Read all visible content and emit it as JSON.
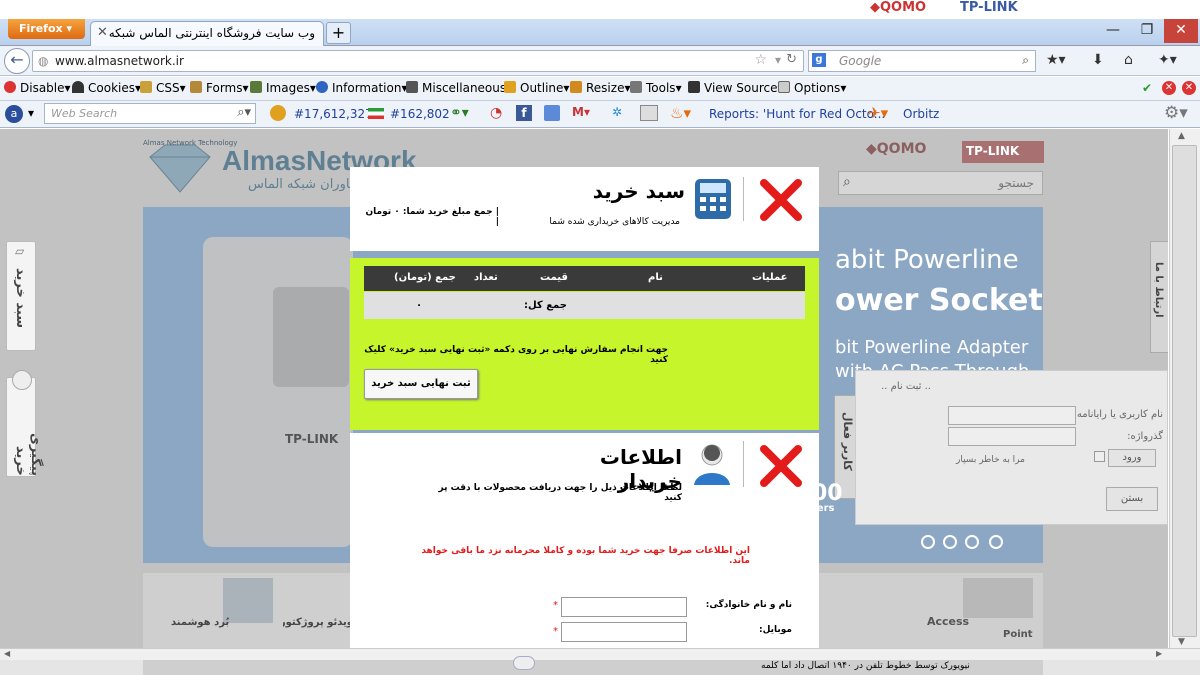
{
  "browser": {
    "app_menu": "Firefox",
    "tab_title": "وب سایت فروشگاه اینترنتی الماس شبکه",
    "new_tab": "+",
    "url": "www.almasnetwork.ir",
    "search_placeholder": "Google",
    "window_buttons": [
      "—",
      "❐",
      "✕"
    ]
  },
  "dev_toolbar": {
    "items": [
      "Disable",
      "Cookies",
      "CSS",
      "Forms",
      "Images",
      "Information",
      "Miscellaneous",
      "Outline",
      "Resize",
      "Tools",
      "View Source",
      "Options"
    ]
  },
  "third_toolbar": {
    "web_search_placeholder": "Web Search",
    "alexa_rank": "#17,612,327",
    "country_rank": "#162,802",
    "news": "Reports: 'Hunt for Red Octo...",
    "orbitz": "Orbitz"
  },
  "site": {
    "logo_name": "AlmasNetwork",
    "logo_sub": "فناوران شبکه الماس",
    "logo_tagline": "Almas Network Technology",
    "search_placeholder": "جستجو",
    "banner_line1": "abit Powerline",
    "banner_line2": "ower Socket",
    "banner_line3": "bit Powerline Adapter",
    "banner_line4": "with AC Pass Through",
    "product_brand": "TP-LINK",
    "side_tab_cart": "سبد خرید",
    "side_tab_track": "پیگیری خرید",
    "side_tab_right": "ارتباط با ما",
    "user_panel_tab": "کاربر فعال",
    "login_title": ".. ثبت نام ..",
    "login_username_label": "نام کاربری یا رایانامه:",
    "login_password_label": "گذرواژه:",
    "login_remember": "مرا به خاطر بسپار",
    "login_button": "ورود",
    "close_button": "بستن",
    "bottom_ticker": "نیویورک توسط خطوط تلفن در ۱۹۴۰ اتصال داد اما کلمه",
    "cat_1": "بُرد هوشمند",
    "cat_2": "ویدئو پروژکتور",
    "cat_3": "Access",
    "cat_4": "Point",
    "stat_num": "00",
    "stat_text": "ters"
  },
  "cart": {
    "title": "سبد خرید",
    "subtitle": "مدیریت کالاهای خریداری شده شما",
    "total_label": "| جمع مبلغ خرید شما: ۰ تومان |",
    "columns": [
      "عملیات",
      "نام",
      "قیمت",
      "تعداد",
      "جمع (تومان)"
    ],
    "total_row_label": "جمع کل:",
    "total_row_value": "۰",
    "instructions": "جهت انجام سفارش نهایی بر روی دکمه «ثبت نهایی سبد خرید» کلیک کنید",
    "submit_button": "ثبت نهایی سبد خرید"
  },
  "buyer": {
    "title": "اطلاعات خریدار",
    "subtitle": "لطفا اطلاعات ذیل را جهت دریافت محصولات با دقت پر کنید",
    "notice": "این اطلاعات صرفا جهت خرید شما بوده و کاملا محرمانه نزد ما باقی خواهد ماند.",
    "field_name_label": "نام و نام خانوادگی:",
    "field_mobile_label": "موبایل:",
    "required_mark": "*"
  },
  "colors": {
    "green_panel": "#c6f52b",
    "red_x": "#e41b1b",
    "dim_overlay": "#c2c2c2"
  }
}
